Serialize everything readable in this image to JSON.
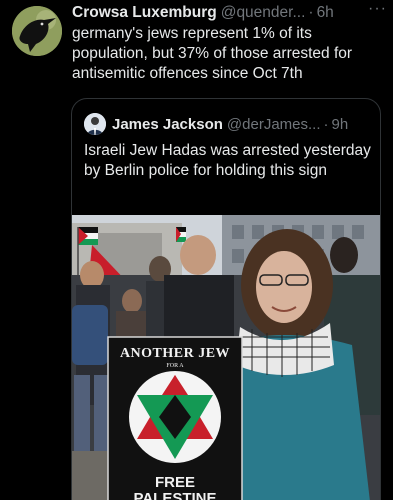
{
  "tweet": {
    "author_name": "Crowsa Luxemburg",
    "author_handle": "@quender...",
    "separator": "·",
    "time": "6h",
    "more_label": "···",
    "text": "germany's jews represent 1% of its population, but 37% of those arrested for antisemitic offences since Oct 7th",
    "avatar_icon": "crow-avatar-icon"
  },
  "quoted_tweet": {
    "author_name": "James Jackson",
    "author_handle": "@derJames...",
    "separator": "·",
    "time": "9h",
    "text": "Israeli Jew Hadas was arrested yesterday by Berlin police for holding this sign",
    "avatar_icon": "person-avatar-icon"
  },
  "photo": {
    "sign_line1": "ANOTHER JEW",
    "sign_line2": "FOR A",
    "sign_line3a": "FREE",
    "sign_line3b": "PALESTINE"
  },
  "colors": {
    "background": "#000000",
    "text_primary": "#e7e9ea",
    "text_secondary": "#71767b",
    "border": "#2f3336"
  }
}
